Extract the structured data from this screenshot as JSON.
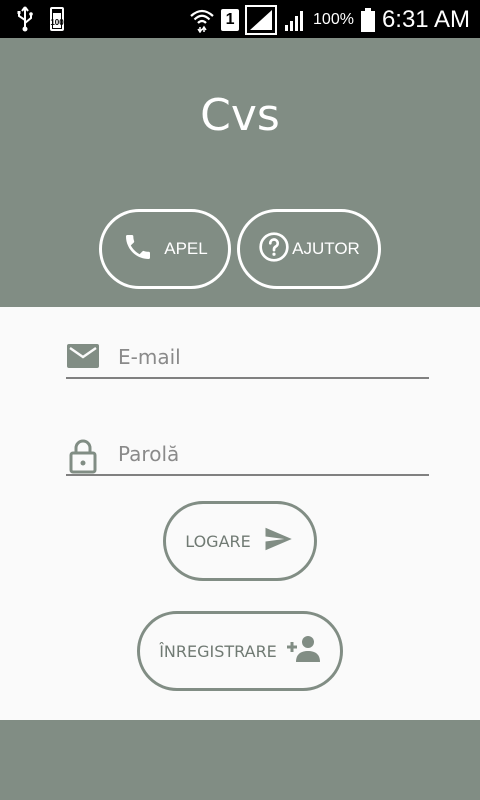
{
  "status_bar": {
    "battery_icon_label": "100",
    "sim_slot": "1",
    "battery_percent": "100%",
    "time": "6:31 AM"
  },
  "header": {
    "title": "Cvs",
    "call_label": "APEL",
    "help_label": "AJUTOR"
  },
  "form": {
    "email_placeholder": "E-mail",
    "password_placeholder": "Parolă",
    "login_label": "LOGARE",
    "register_label": "ÎNREGISTRARE"
  },
  "colors": {
    "header_bg": "#818d84",
    "page_bg": "#fafafa",
    "status_bg": "#000000",
    "underline": "#808080"
  },
  "icons": {
    "call": "phone-icon",
    "help": "help-circle-icon",
    "email": "mail-icon",
    "password": "lock-icon",
    "login": "send-icon",
    "register": "add-person-icon"
  }
}
